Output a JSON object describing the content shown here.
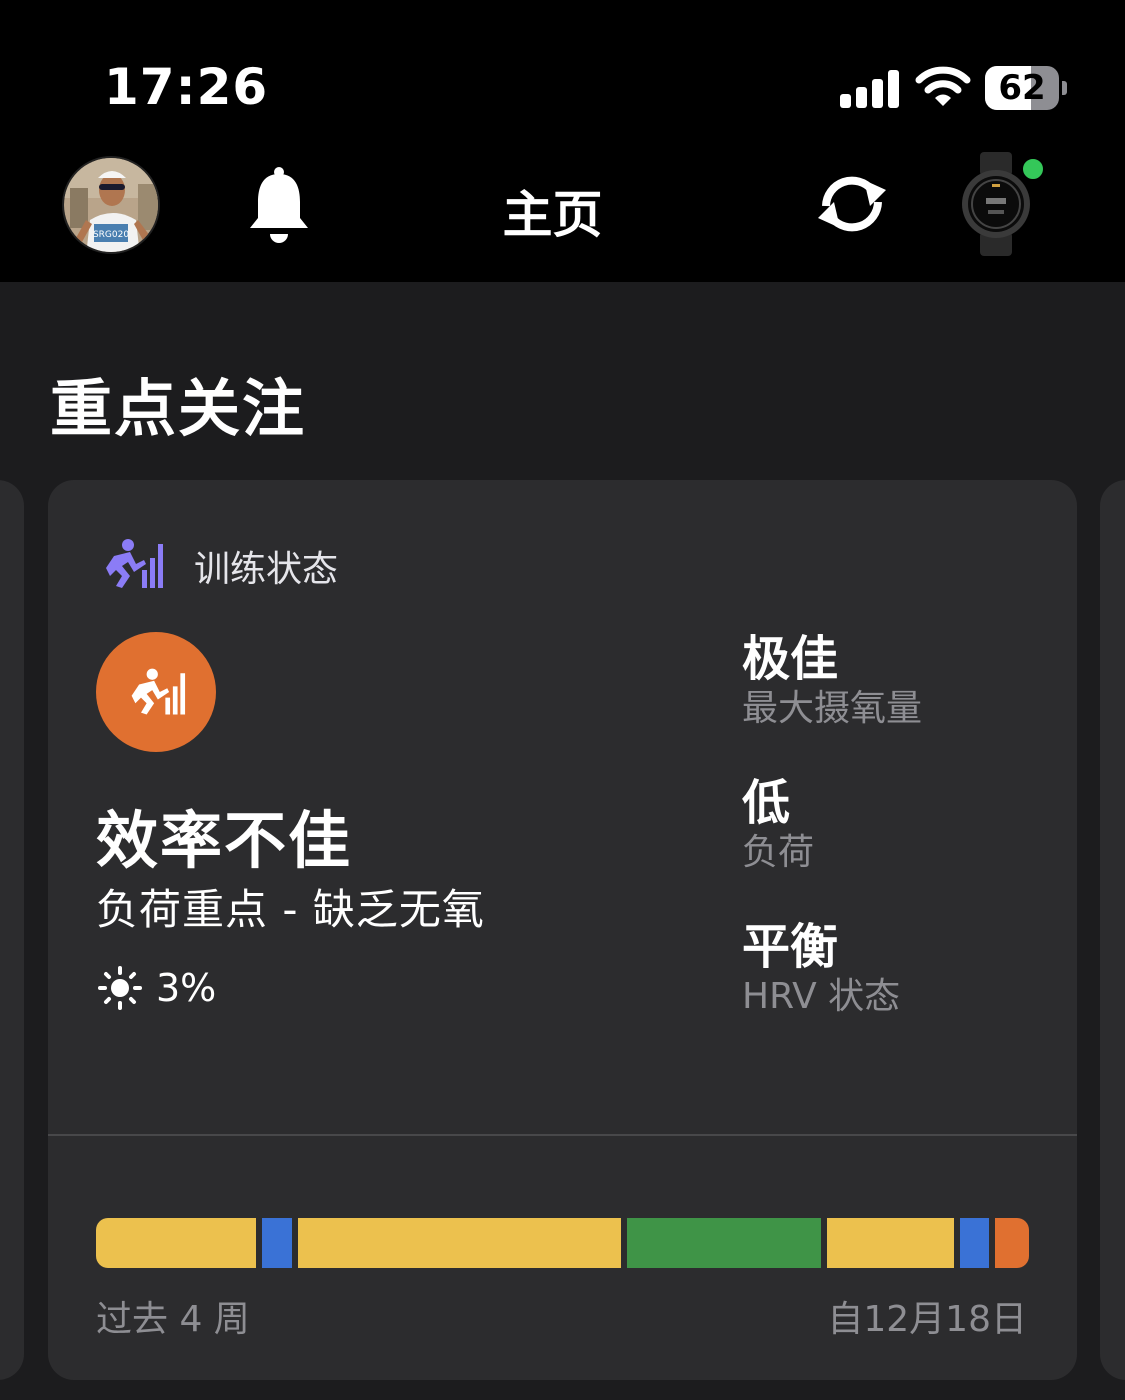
{
  "status_bar": {
    "time": "17:26",
    "battery": "62",
    "battery_level": 0.62
  },
  "nav": {
    "title": "主页",
    "icons": [
      "avatar",
      "bell-icon",
      "sync-icon",
      "watch-icon"
    ],
    "device_status_color": "#34c759"
  },
  "section": {
    "title": "重点关注"
  },
  "card": {
    "label": "训练状态",
    "icon_color": "#8b7cf6",
    "status_circle_color": "#e07030",
    "status_main": "效率不佳",
    "status_sub": "负荷重点 - 缺乏无氧",
    "heat_value": "3%",
    "metrics": [
      {
        "value": "极佳",
        "label": "最大摄氧量"
      },
      {
        "value": "低",
        "label": "负荷"
      },
      {
        "value": "平衡",
        "label": "HRV 状态"
      }
    ],
    "timeline": {
      "segments": [
        {
          "status": "yellow",
          "color": "#ecc14e",
          "share": 0.174
        },
        {
          "status": "blue",
          "color": "#3a72d6",
          "share": 0.032
        },
        {
          "status": "yellow",
          "color": "#ecc14e",
          "share": 0.352
        },
        {
          "status": "green",
          "color": "#3f9447",
          "share": 0.211
        },
        {
          "status": "yellow",
          "color": "#ecc14e",
          "share": 0.137
        },
        {
          "status": "blue",
          "color": "#3a72d6",
          "share": 0.032
        },
        {
          "status": "orange",
          "color": "#e07030",
          "share": 0.037
        }
      ],
      "left_label": "过去 4 周",
      "right_label": "自12月18日"
    }
  }
}
